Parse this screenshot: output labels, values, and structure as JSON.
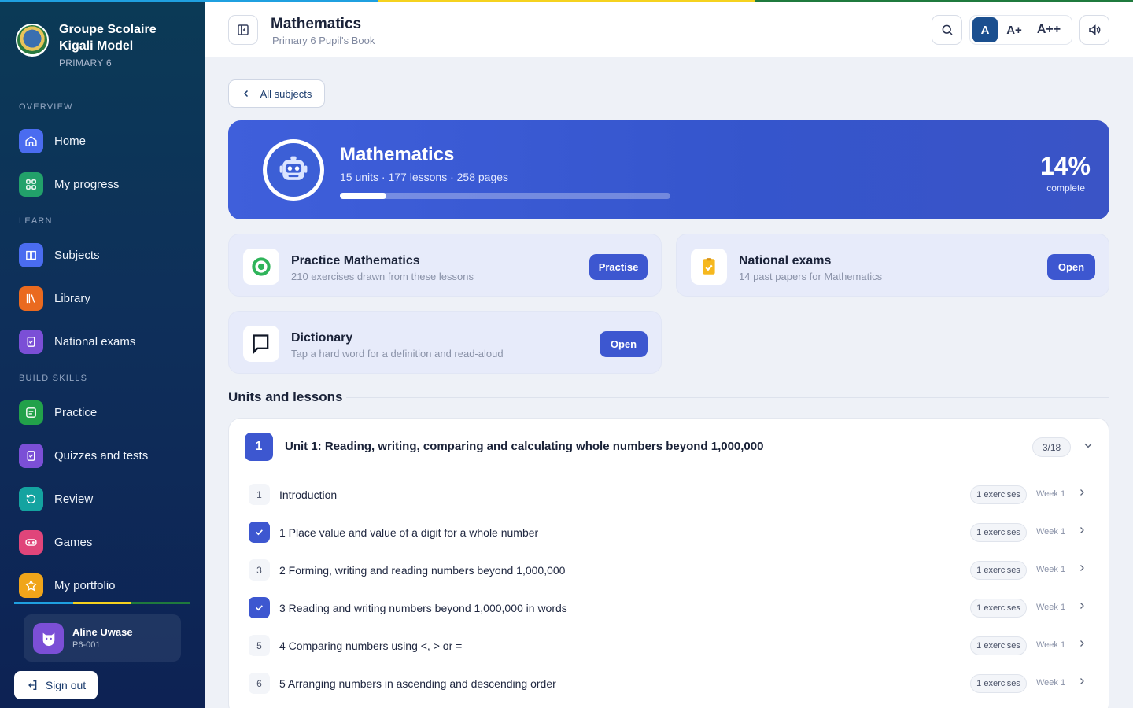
{
  "colors": {
    "flag_blue": "#1fa0e0",
    "flag_yellow": "#f5d21f",
    "flag_green": "#1f7a3d",
    "accent": "#3d57d0"
  },
  "school": {
    "name": "Groupe Scolaire Kigali Model",
    "grade": "PRIMARY 6"
  },
  "nav": {
    "overview_label": "OVERVIEW",
    "learn_label": "LEARN",
    "build_label": "BUILD SKILLS",
    "home": "Home",
    "progress": "My progress",
    "subjects": "Subjects",
    "library": "Library",
    "exams": "National exams",
    "practice": "Practice",
    "quizzes": "Quizzes and tests",
    "review": "Review",
    "games": "Games",
    "portfolio": "My portfolio"
  },
  "user": {
    "name": "Aline Uwase",
    "id": "P6-001",
    "signout": "Sign out"
  },
  "header": {
    "title": "Mathematics",
    "subtitle": "Primary 6 Pupil's Book",
    "font_a": "A",
    "font_a_plus": "A+",
    "font_a_plus_plus": "A++"
  },
  "back": {
    "label": "All subjects"
  },
  "hero": {
    "title": "Mathematics",
    "summary": "15 units · 177 lessons · 258 pages",
    "percent": "14%",
    "percent_label": "complete",
    "progress": 0.14
  },
  "cards": {
    "practice": {
      "title": "Practice Mathematics",
      "sub": "210 exercises drawn from these lessons",
      "button": "Practise"
    },
    "exams": {
      "title": "National exams",
      "sub": "14 past papers for Mathematics",
      "button": "Open"
    },
    "dictionary": {
      "title": "Dictionary",
      "sub": "Tap a hard word for a definition and read-aloud",
      "button": "Open"
    }
  },
  "units_heading": "Units and lessons",
  "unit": {
    "number": "1",
    "title": "Unit 1: Reading, writing, comparing and calculating whole numbers beyond 1,000,000",
    "count": "3/18",
    "lessons": [
      {
        "marker": "1",
        "done": false,
        "name": "Introduction",
        "exercises": "1 exercises",
        "week": "Week 1"
      },
      {
        "marker": "",
        "done": true,
        "name": "1 Place value and value of a digit for a whole number",
        "exercises": "1 exercises",
        "week": "Week 1"
      },
      {
        "marker": "3",
        "done": false,
        "name": "2 Forming, writing and reading numbers beyond 1,000,000",
        "exercises": "1 exercises",
        "week": "Week 1"
      },
      {
        "marker": "",
        "done": true,
        "name": "3 Reading and writing numbers beyond 1,000,000 in words",
        "exercises": "1 exercises",
        "week": "Week 1"
      },
      {
        "marker": "5",
        "done": false,
        "name": "4 Comparing numbers using <, > or =",
        "exercises": "1 exercises",
        "week": "Week 1"
      },
      {
        "marker": "6",
        "done": false,
        "name": "5 Arranging numbers in ascending and descending order",
        "exercises": "1 exercises",
        "week": "Week 1"
      }
    ]
  }
}
